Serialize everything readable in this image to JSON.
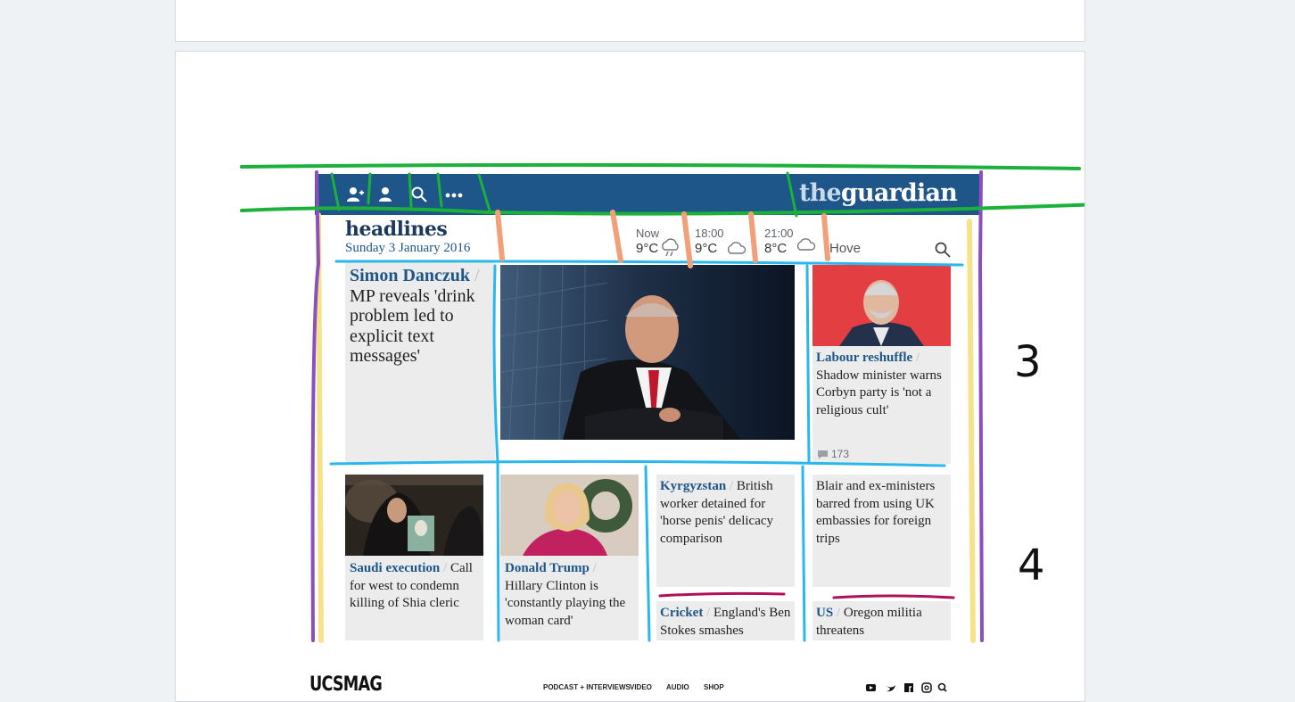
{
  "brand": {
    "logo_the": "the",
    "logo_guardian": "guardian"
  },
  "topbar": {
    "icons": [
      "add-user-icon",
      "user-icon",
      "search-icon",
      "more-icon"
    ]
  },
  "headlines": {
    "title": "headlines",
    "date": "Sunday 3 January 2016"
  },
  "weather": {
    "slots": [
      {
        "label": "Now",
        "temp": "9°C",
        "icon": "rain-cloud-icon"
      },
      {
        "label": "18:00",
        "temp": "9°C",
        "icon": "cloud-icon"
      },
      {
        "label": "21:00",
        "temp": "8°C",
        "icon": "cloud-icon"
      }
    ],
    "location": "Hove"
  },
  "stories": {
    "lead": {
      "kicker": "Simon Danczuk",
      "headline": "MP reveals 'drink problem led to explicit text messages'"
    },
    "labour": {
      "kicker": "Labour reshuffle",
      "headline": "Shadow minister warns Corbyn party is 'not a religious cult'",
      "comments": "173"
    },
    "saudi": {
      "kicker": "Saudi execution",
      "headline": "Call for west to condemn killing of Shia cleric"
    },
    "trump": {
      "kicker": "Donald Trump",
      "headline": "Hillary Clinton is 'constantly playing the woman card'"
    },
    "kyrgyzstan": {
      "kicker": "Kyrgyzstan",
      "headline": "British worker detained for 'horse penis' delicacy comparison"
    },
    "blair": {
      "headline": "Blair and ex-ministers barred from using UK embassies for foreign trips"
    },
    "cricket": {
      "kicker": "Cricket",
      "headline": "England's Ben Stokes smashes"
    },
    "us": {
      "kicker": "US",
      "headline": "Oregon militia threatens"
    }
  },
  "annotations": {
    "row3": "3",
    "row4": "4"
  },
  "footer": {
    "logo": "UCSMAG",
    "nav": [
      "PODCAST + INTERVIEWS",
      "VIDEO",
      "AUDIO",
      "SHOP"
    ],
    "social_icons": [
      "youtube-icon",
      "twitter-icon",
      "facebook-icon",
      "instagram-icon",
      "search-icon"
    ]
  },
  "colors": {
    "guardian_blue": "#1e5689",
    "green": "#1bb13a",
    "cyan": "#2ab8ec",
    "purple": "#8c4fbf",
    "yellow": "#f5e38a",
    "orange": "#f2a07a",
    "magenta": "#b0105a"
  }
}
